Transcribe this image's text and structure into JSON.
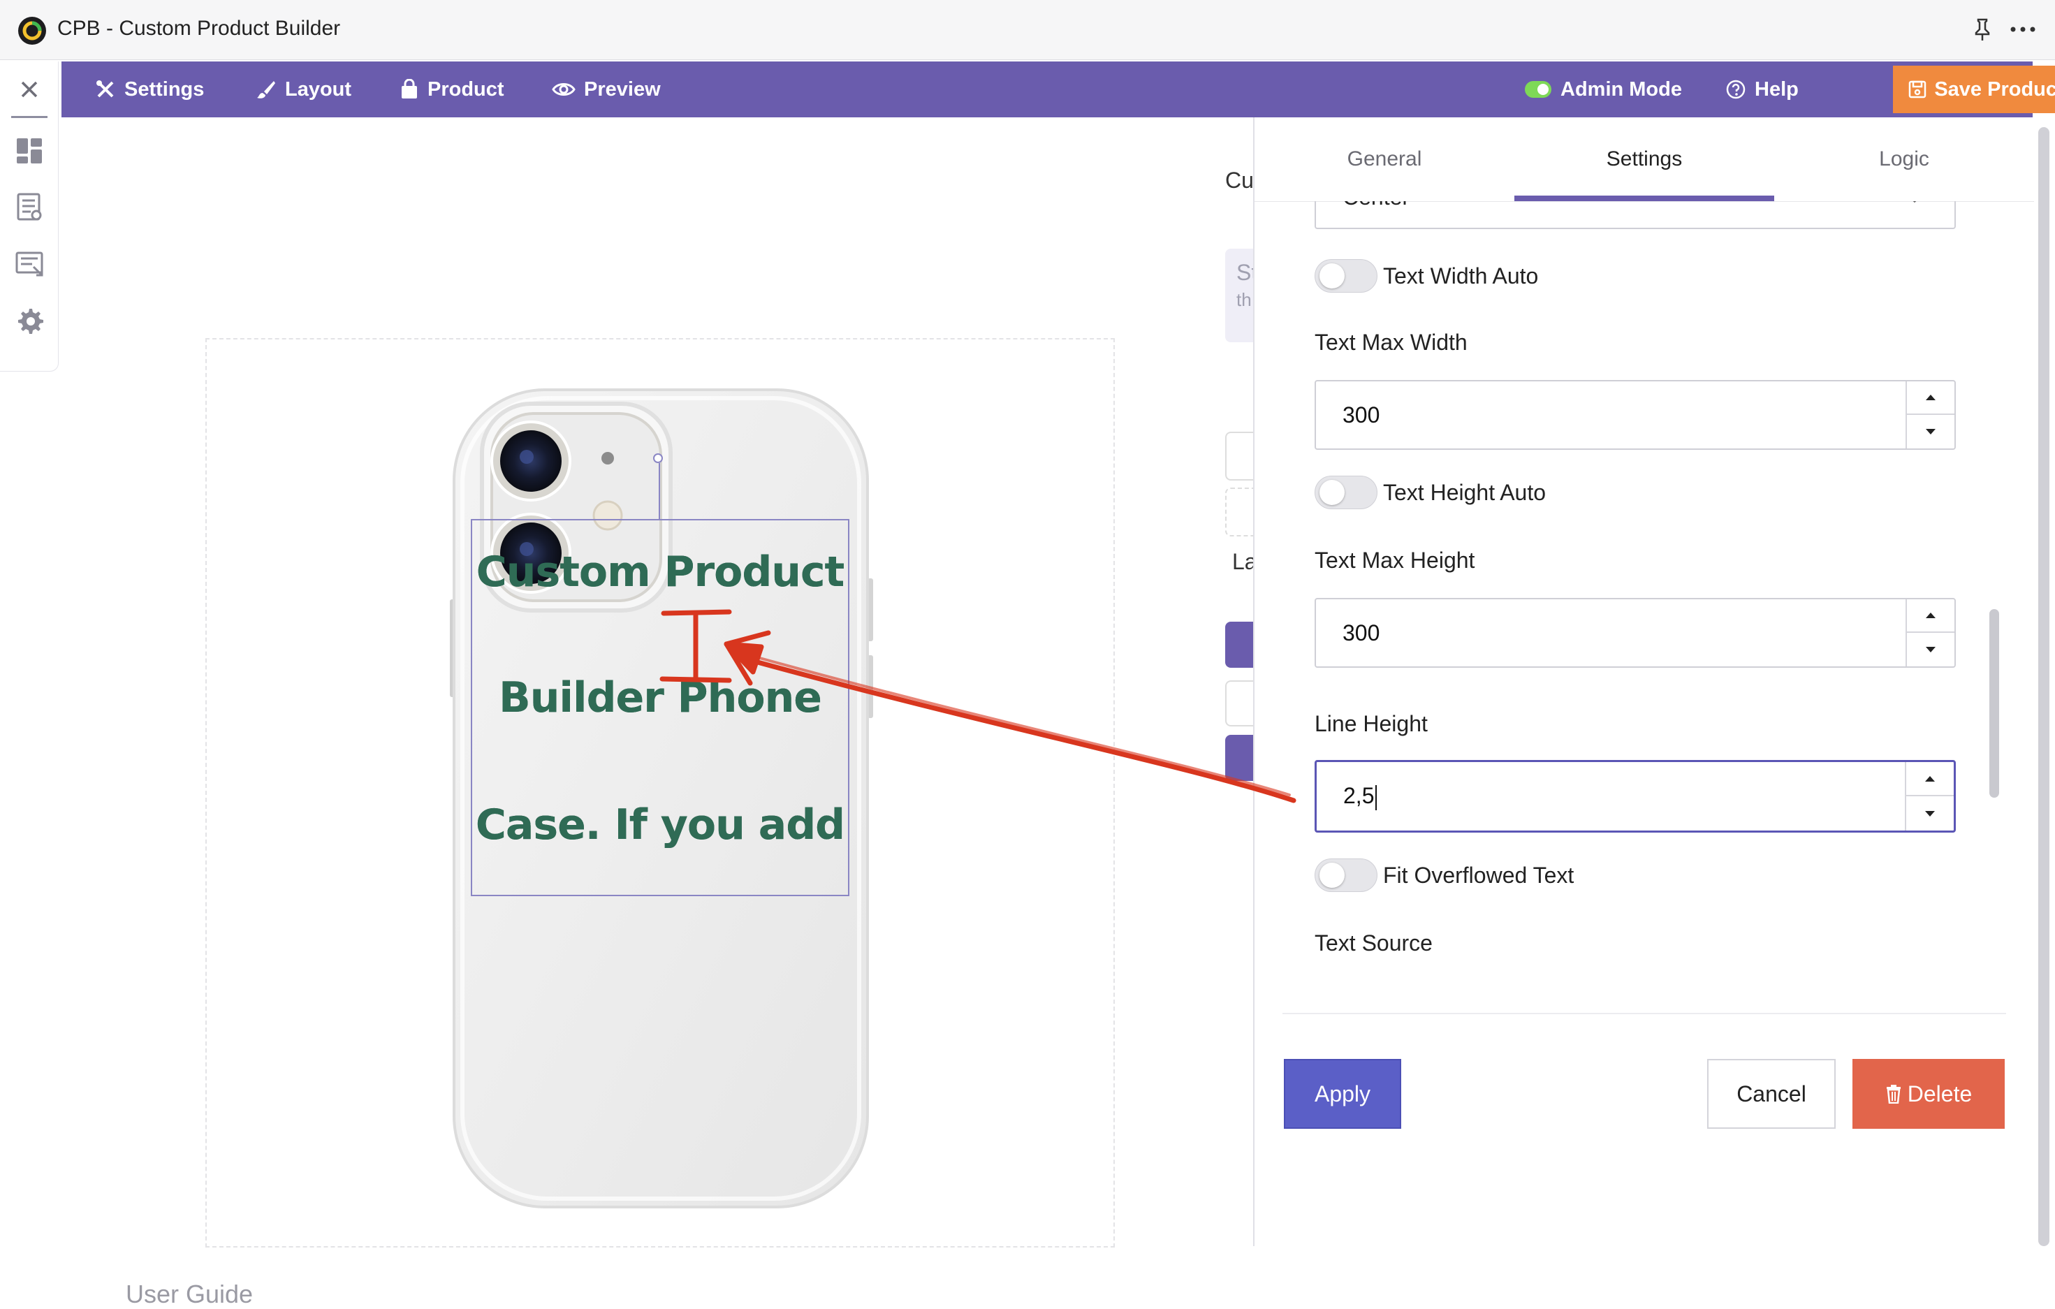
{
  "window": {
    "title": "CPB - Custom Product Builder"
  },
  "toolbar": {
    "settings": "Settings",
    "layout": "Layout",
    "product": "Product",
    "preview": "Preview",
    "admin_mode": "Admin Mode",
    "help": "Help",
    "save": "Save Product"
  },
  "colors": {
    "toolbar_bg": "#6a5cad",
    "save_button": "#f08a3e",
    "apply_button": "#5b5fc7",
    "delete_button": "#e2654b",
    "tab_underline": "#6a5cad",
    "admin_toggle_on": "#7ed957",
    "annotation_arrow": "#d8361e",
    "phone_text": "#2f6b55"
  },
  "rail": {
    "icons": [
      "close-icon",
      "dashboard-icon",
      "list-icon",
      "form-icon",
      "gear-icon"
    ]
  },
  "canvas": {
    "text_lines": [
      "Custom Product",
      "Builder Phone",
      "Case. If you add"
    ],
    "user_guide": "User Guide"
  },
  "background_fragments": {
    "cu": "Cu",
    "st": "St",
    "th": "th",
    "la": "La"
  },
  "panel": {
    "tabs": [
      {
        "label": "General",
        "active": false
      },
      {
        "label": "Settings",
        "active": true
      },
      {
        "label": "Logic",
        "active": false
      }
    ],
    "alignment_value": "Center",
    "text_width_auto": {
      "label": "Text Width Auto",
      "on": false
    },
    "text_max_width": {
      "label": "Text Max Width",
      "value": "300"
    },
    "text_height_auto": {
      "label": "Text Height Auto",
      "on": false
    },
    "text_max_height": {
      "label": "Text Max Height",
      "value": "300"
    },
    "line_height": {
      "label": "Line Height",
      "value": "2,5"
    },
    "fit_overflowed": {
      "label": "Fit Overflowed Text",
      "on": false
    },
    "text_source": {
      "label": "Text Source"
    }
  },
  "actions": {
    "apply": "Apply",
    "cancel": "Cancel",
    "delete": "Delete"
  }
}
